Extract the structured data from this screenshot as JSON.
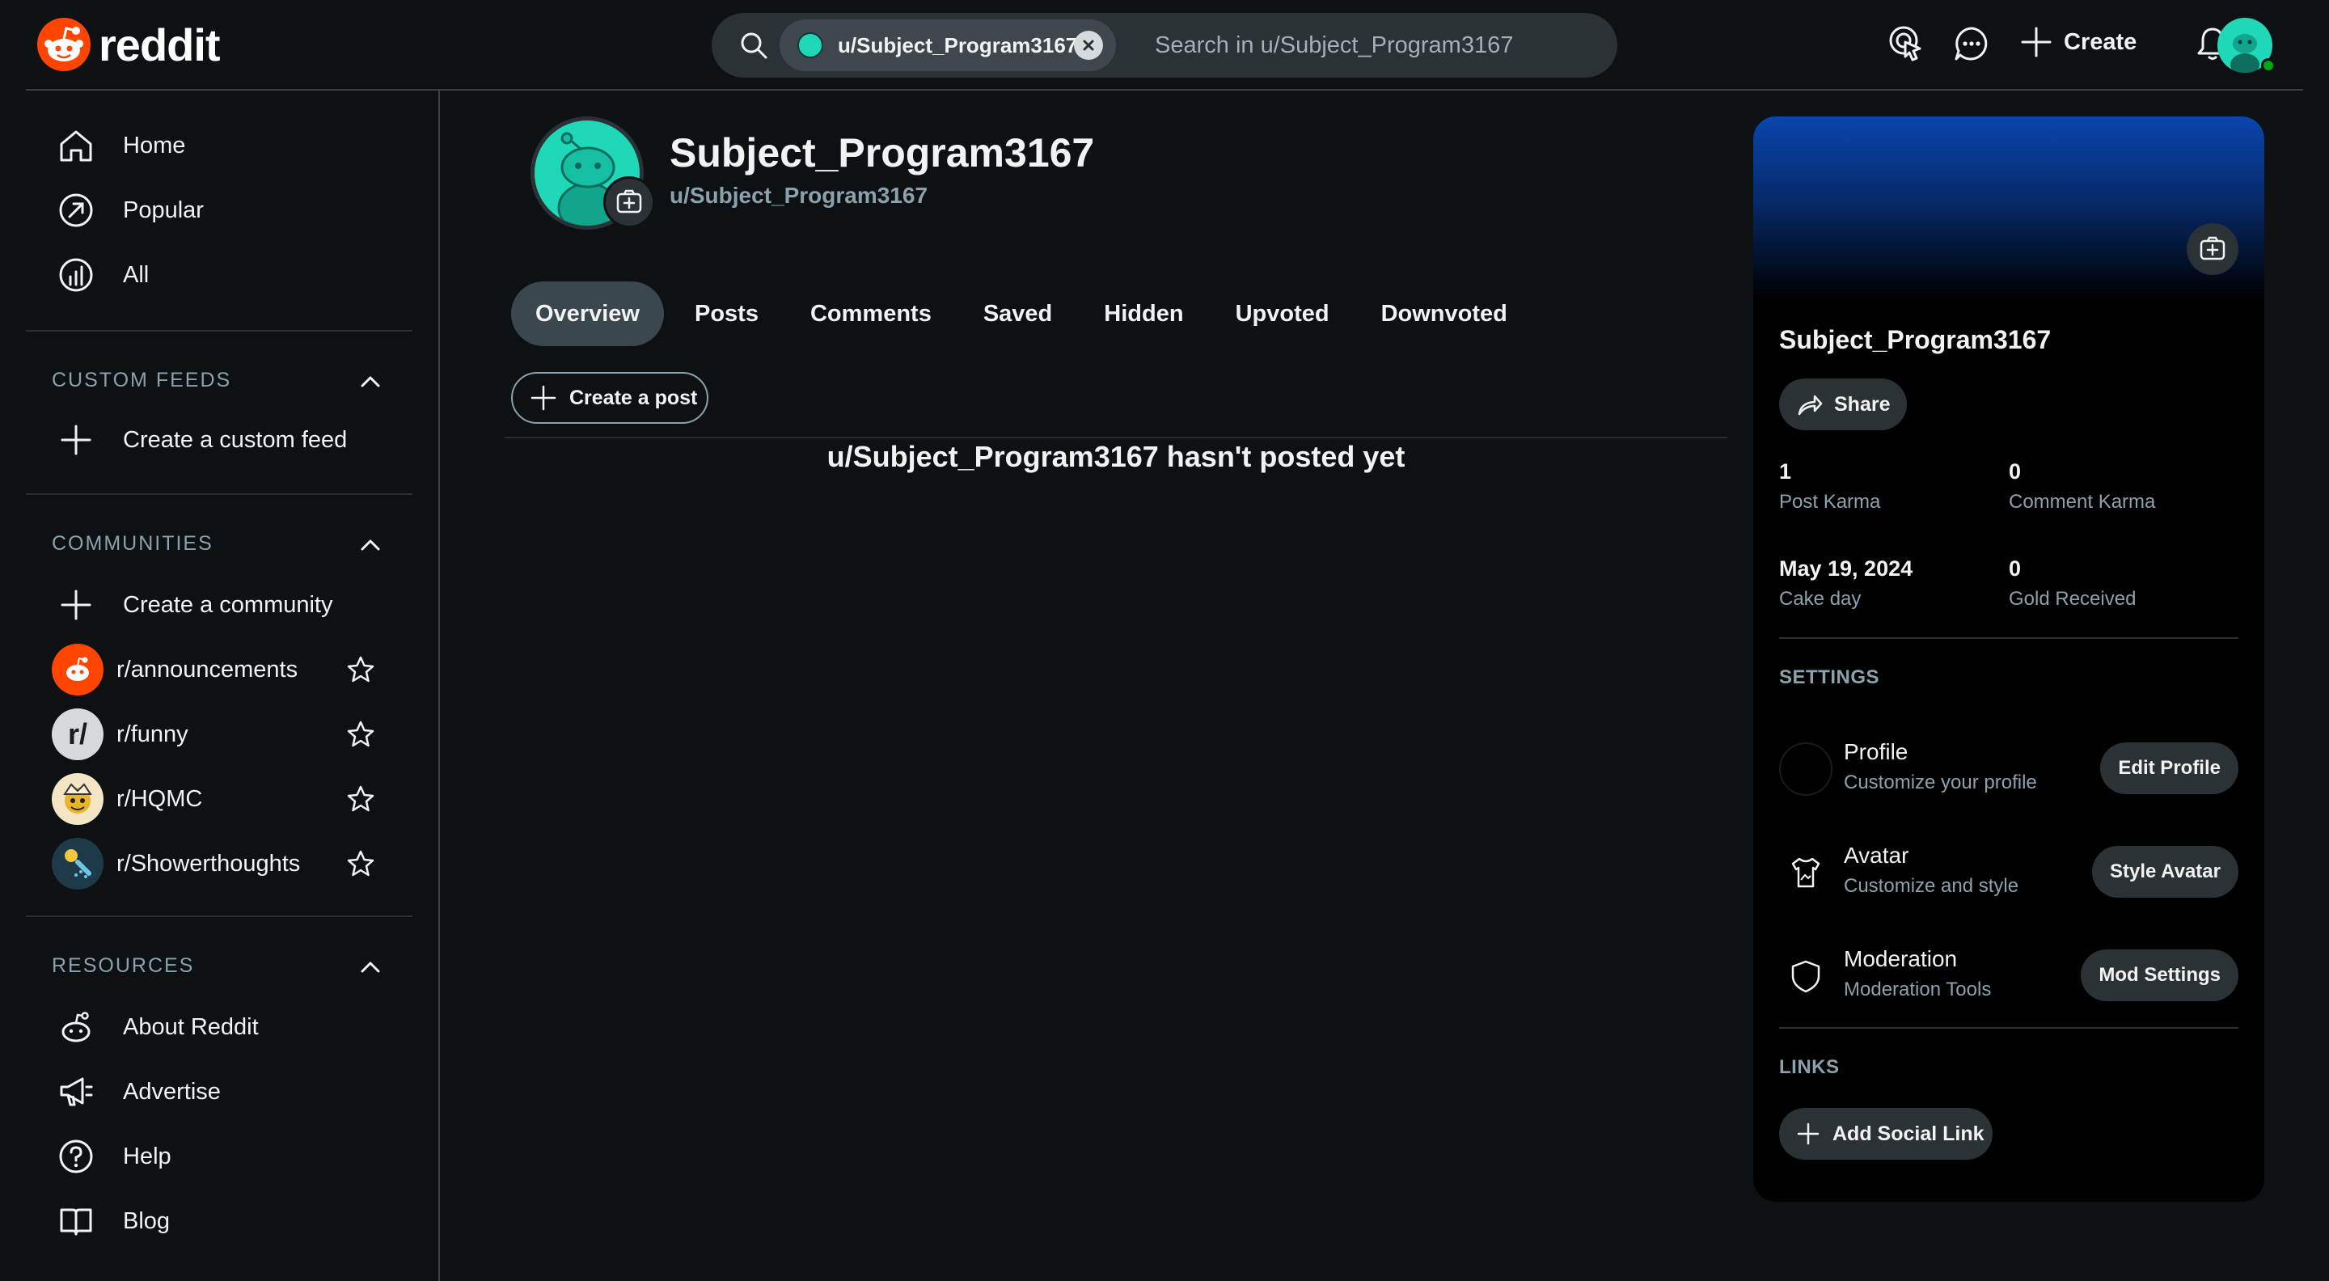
{
  "header": {
    "logo_text": "reddit",
    "search_chip_label": "u/Subject_Program3167",
    "search_placeholder": "Search in u/Subject_Program3167",
    "create_label": "Create"
  },
  "sidebar": {
    "nav": [
      {
        "label": "Home",
        "icon": "home-icon"
      },
      {
        "label": "Popular",
        "icon": "popular-icon"
      },
      {
        "label": "All",
        "icon": "all-icon"
      }
    ],
    "custom_feeds": {
      "title": "CUSTOM FEEDS",
      "create_label": "Create a custom feed"
    },
    "communities": {
      "title": "COMMUNITIES",
      "create_label": "Create a community",
      "items": [
        {
          "label": "r/announcements"
        },
        {
          "label": "r/funny"
        },
        {
          "label": "r/HQMC"
        },
        {
          "label": "r/Showerthoughts"
        }
      ]
    },
    "resources": {
      "title": "RESOURCES",
      "items": [
        {
          "label": "About Reddit",
          "icon": "reddit-alien-icon"
        },
        {
          "label": "Advertise",
          "icon": "megaphone-icon"
        },
        {
          "label": "Help",
          "icon": "help-icon"
        },
        {
          "label": "Blog",
          "icon": "book-icon"
        }
      ]
    }
  },
  "profile": {
    "display_name": "Subject_Program3167",
    "handle": "u/Subject_Program3167",
    "tabs": [
      "Overview",
      "Posts",
      "Comments",
      "Saved",
      "Hidden",
      "Upvoted",
      "Downvoted"
    ],
    "active_tab": "Overview",
    "create_post_label": "Create a post",
    "empty_message": "u/Subject_Program3167 hasn't posted yet"
  },
  "card": {
    "name": "Subject_Program3167",
    "share_label": "Share",
    "stats": [
      {
        "value": "1",
        "label": "Post Karma"
      },
      {
        "value": "0",
        "label": "Comment Karma"
      },
      {
        "value": "May 19, 2024",
        "label": "Cake day"
      },
      {
        "value": "0",
        "label": "Gold Received"
      }
    ],
    "settings_title": "SETTINGS",
    "settings": [
      {
        "title": "Profile",
        "subtitle": "Customize your profile",
        "button": "Edit Profile"
      },
      {
        "title": "Avatar",
        "subtitle": "Customize and style",
        "button": "Style Avatar"
      },
      {
        "title": "Moderation",
        "subtitle": "Moderation Tools",
        "button": "Mod Settings"
      }
    ],
    "links_title": "LINKS",
    "add_social_label": "Add Social Link"
  },
  "colors": {
    "background": "#0e1113",
    "accent_orange": "#ff4500",
    "avatar_teal": "#1fd8b8",
    "banner_blue": "#0a45ad",
    "muted_text": "#8ba2ad"
  }
}
